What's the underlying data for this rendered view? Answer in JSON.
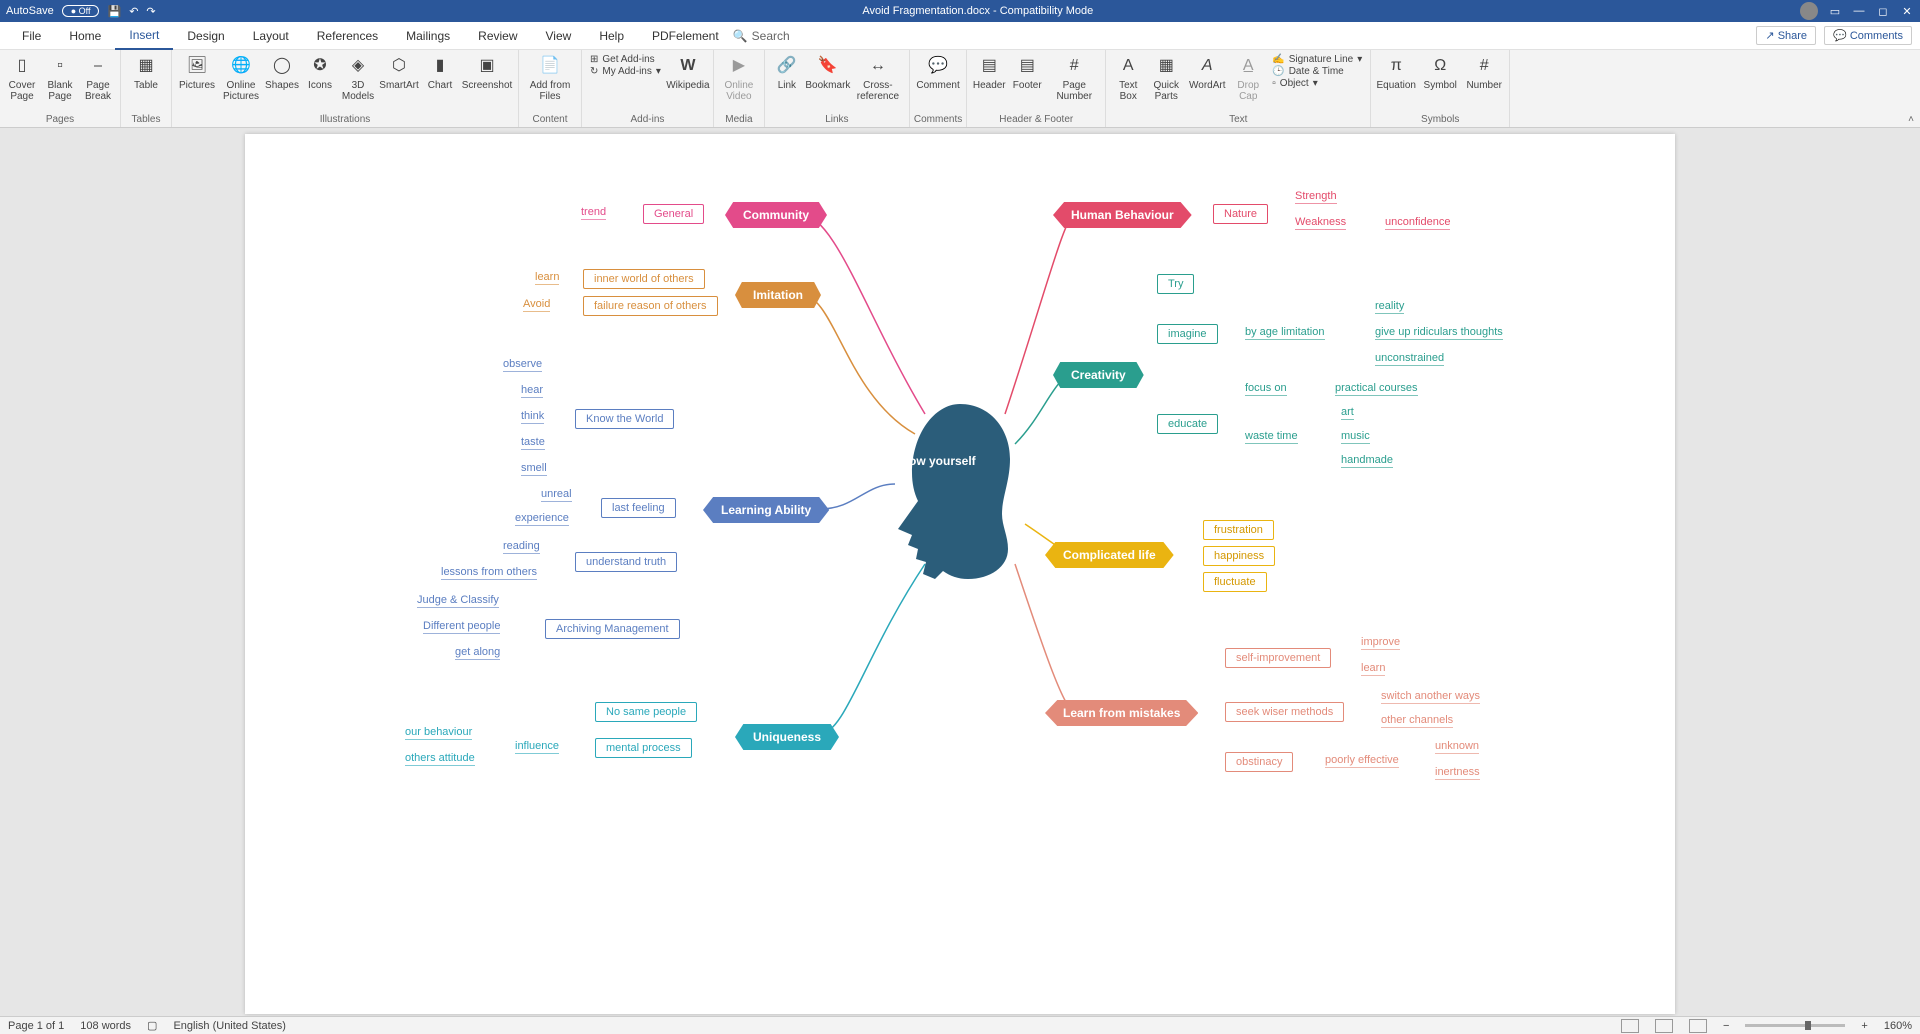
{
  "titlebar": {
    "autosave_label": "AutoSave",
    "autosave_state": "Off",
    "doc_title": "Avoid Fragmentation.docx  -  Compatibility Mode"
  },
  "tabs": {
    "file": "File",
    "home": "Home",
    "insert": "Insert",
    "design": "Design",
    "layout": "Layout",
    "references": "References",
    "mailings": "Mailings",
    "review": "Review",
    "view": "View",
    "help": "Help",
    "pdfelement": "PDFelement",
    "search": "Search",
    "share": "Share",
    "comments": "Comments"
  },
  "ribbon": {
    "pages": {
      "group": "Pages",
      "cover_page": "Cover Page",
      "blank_page": "Blank Page",
      "page_break": "Page Break"
    },
    "tables": {
      "group": "Tables",
      "table": "Table"
    },
    "illustrations": {
      "group": "Illustrations",
      "pictures": "Pictures",
      "online_pictures": "Online Pictures",
      "shapes": "Shapes",
      "icons": "Icons",
      "models_3d": "3D Models",
      "smartart": "SmartArt",
      "chart": "Chart",
      "screenshot": "Screenshot"
    },
    "content": {
      "group": "Content",
      "add_from_files": "Add from Files"
    },
    "addins": {
      "group": "Add-ins",
      "get_addins": "Get Add-ins",
      "my_addins": "My Add-ins",
      "wikipedia": "Wikipedia"
    },
    "media": {
      "group": "Media",
      "online_video": "Online Video"
    },
    "links": {
      "group": "Links",
      "link": "Link",
      "bookmark": "Bookmark",
      "crossref": "Cross-reference"
    },
    "comments": {
      "group": "Comments",
      "comment": "Comment"
    },
    "headerfooter": {
      "group": "Header & Footer",
      "header": "Header",
      "footer": "Footer",
      "pagenum": "Page Number"
    },
    "text": {
      "group": "Text",
      "textbox": "Text Box",
      "quickparts": "Quick Parts",
      "wordart": "WordArt",
      "dropcap": "Drop Cap",
      "sigline": "Signature Line",
      "datetime": "Date & Time",
      "object": "Object"
    },
    "symbols": {
      "group": "Symbols",
      "equation": "Equation",
      "symbol": "Symbol",
      "number": "Number"
    }
  },
  "status": {
    "page": "Page 1 of 1",
    "words": "108 words",
    "lang": "English (United States)",
    "zoom": "160%"
  },
  "mindmap": {
    "center": "Know yourself",
    "community": {
      "label": "Community",
      "general": "General",
      "trend": "trend"
    },
    "imitation": {
      "label": "Imitation",
      "inner": "inner world of others",
      "failure": "failure reason of others",
      "learn": "learn",
      "avoid": "Avoid"
    },
    "learning": {
      "label": "Learning Ability",
      "know_world": "Know the World",
      "observe": "observe",
      "hear": "hear",
      "think": "think",
      "taste": "taste",
      "smell": "smell",
      "last_feeling": "last feeling",
      "unreal": "unreal",
      "experience": "experience",
      "understand": "understand truth",
      "reading": "reading",
      "lessons": "lessons from others",
      "archiving": "Archiving Management",
      "judge": "Judge & Classify",
      "different": "Different people",
      "getalong": "get along"
    },
    "uniqueness": {
      "label": "Uniqueness",
      "nosame": "No same people",
      "mental": "mental process",
      "influence": "influence",
      "behaviour": "our behaviour",
      "attitude": "others attitude"
    },
    "human": {
      "label": "Human Behaviour",
      "nature": "Nature",
      "strength": "Strength",
      "weakness": "Weakness",
      "unconfidence": "unconfidence"
    },
    "creativity": {
      "label": "Creativity",
      "try": "Try",
      "imagine": "imagine",
      "byage": "by age limitation",
      "reality": "reality",
      "giveup": "give up ridiculars thoughts",
      "unconstrained": "unconstrained",
      "educate": "educate",
      "focus": "focus on",
      "waste": "waste time",
      "practical": "practical courses",
      "art": "art",
      "music": "music",
      "handmade": "handmade"
    },
    "complicated": {
      "label": "Complicated life",
      "frustration": "frustration",
      "happiness": "happiness",
      "fluctuate": "fluctuate"
    },
    "mistakes": {
      "label": "Learn from mistakes",
      "selfimprove": "self-improvement",
      "improve": "improve",
      "learn": "learn",
      "wiser": "seek wiser methods",
      "switch": "switch another ways",
      "channels": "other channels",
      "obstinacy": "obstinacy",
      "poorly": "poorly effective",
      "unknown": "unknown",
      "inertness": "inertness"
    }
  }
}
